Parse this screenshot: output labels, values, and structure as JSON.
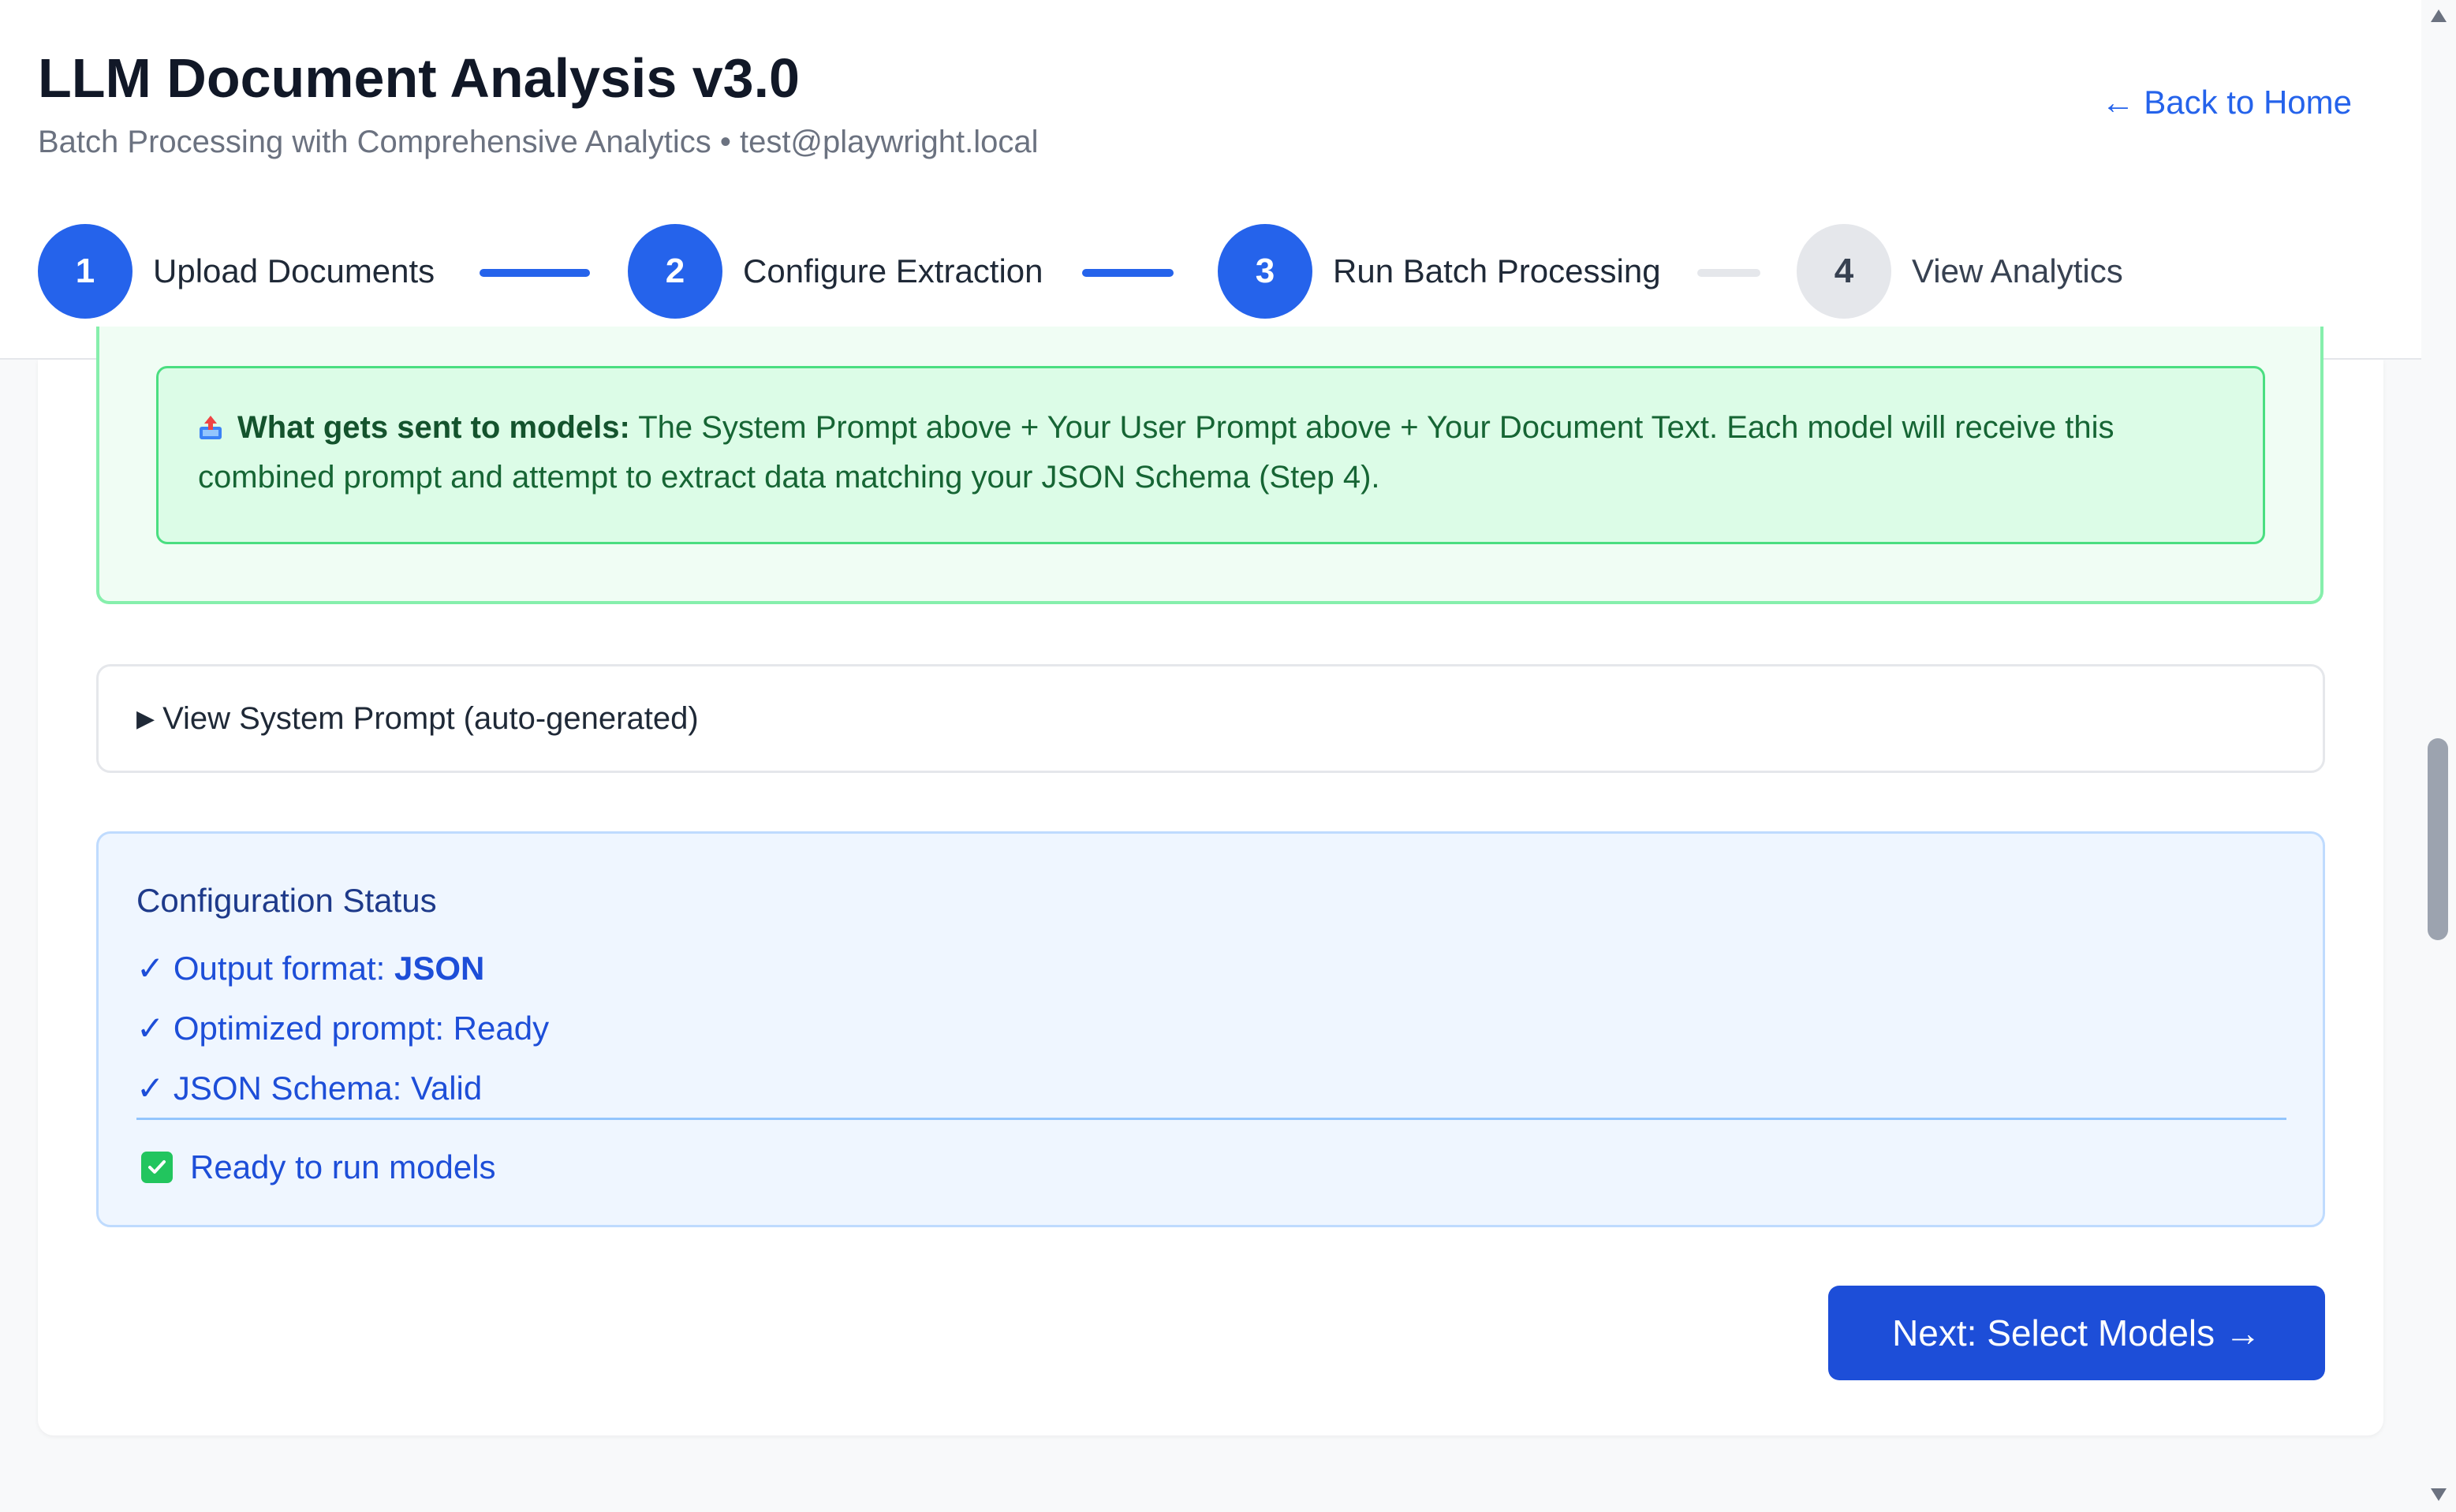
{
  "header": {
    "title": "LLM Document Analysis v3.0",
    "subtitle": "Batch Processing with Comprehensive Analytics • test@playwright.local",
    "back_link": "← Back to Home"
  },
  "steps": [
    {
      "number": "1",
      "label": "Upload Documents",
      "state": "complete"
    },
    {
      "number": "2",
      "label": "Configure Extraction",
      "state": "complete"
    },
    {
      "number": "3",
      "label": "Run Batch Processing",
      "state": "current"
    },
    {
      "number": "4",
      "label": "View Analytics",
      "state": "pending"
    }
  ],
  "info_box": {
    "icon": "outbox-tray-icon",
    "heading": "What gets sent to models:",
    "text": " The System Prompt above + Your User Prompt above + Your Document Text. Each model will receive this combined prompt and attempt to extract data matching your JSON Schema (Step 4)."
  },
  "system_prompt_toggle": {
    "label": "View System Prompt (auto-generated)"
  },
  "config_status": {
    "title": "Configuration Status",
    "items": [
      {
        "check": "✓",
        "label": "Output format: ",
        "value": "JSON"
      },
      {
        "check": "✓",
        "label": "Optimized prompt: Ready"
      },
      {
        "check": "✓",
        "label": "JSON Schema: Valid"
      }
    ],
    "ready_text": "Ready to run models"
  },
  "actions": {
    "next_label": "Next: Select Models →"
  },
  "colors": {
    "primary": "#2563eb",
    "button": "#1d4ed8",
    "success_bg": "#dcfce7",
    "success_border": "#4ade80",
    "status_bg": "#eff6ff",
    "inactive_step": "#e5e7eb"
  }
}
